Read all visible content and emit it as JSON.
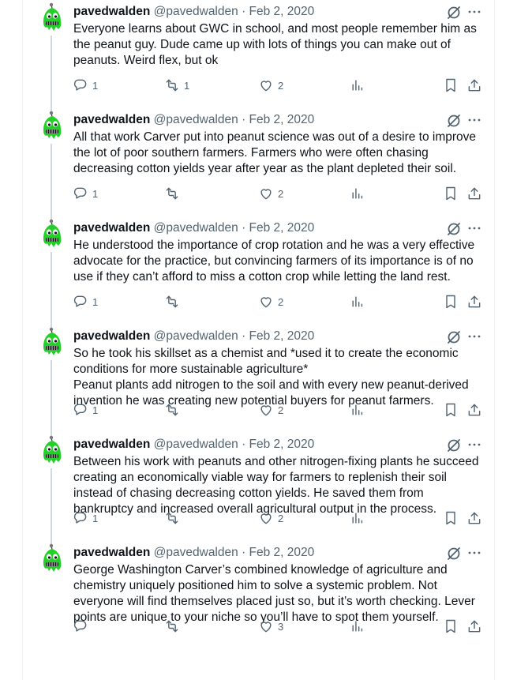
{
  "author": {
    "name": "pavedwalden",
    "handle": "@pavedwalden",
    "date_sep": "·",
    "date": "Feb 2, 2020"
  },
  "icons": {
    "reply": "reply-icon",
    "retweet": "retweet-icon",
    "like": "heart-icon",
    "views": "analytics-icon",
    "bookmark": "bookmark-icon",
    "share": "share-icon",
    "grok": "grok-icon",
    "more": "more-icon"
  },
  "colors": {
    "text": "#0f1419",
    "muted": "#536471",
    "thread_line": "#cfd9de",
    "avatar_green": "#22d028"
  },
  "tweets": [
    {
      "paragraphs": [
        "Everyone learns about GWC in school, and most people remember him as the peanut guy. Dude came up with lots of things you can make out of peanuts. Weird flex, but ok"
      ],
      "replies": "1",
      "retweets": "1",
      "likes": "2"
    },
    {
      "paragraphs": [
        "All that work Carver put into peanut science was out of a desire to improve the lot of poor southern farmers. Farmers who were often chasing decreasing cotton yields year after year as the plant depleted their soil."
      ],
      "replies": "1",
      "retweets": "",
      "likes": "2"
    },
    {
      "paragraphs": [
        "He understood the importance of crop rotation and he was a very effective advocate for the practice, but convincing farmers of its importance is of no use if they can’t afford to miss a cotton crop while letting the land rest."
      ],
      "replies": "1",
      "retweets": "",
      "likes": "2"
    },
    {
      "paragraphs": [
        "So he took his skillset as a chemist and *used it to create the economic conditions for more sustainable agriculture*",
        "Peanut plants add nitrogen to the soil and with every new peanut-derived invention he was creating new potential buyers for peanut farmers."
      ],
      "replies": "1",
      "retweets": "",
      "likes": "2"
    },
    {
      "paragraphs": [
        "Between his work with peanuts and other nitrogen-fixing plants he succeed creating an economically viable way for farmers to replenish their soil instead of chasing decreasing cotton yields. He saved them from bankruptcy and increased overall agricultural output in the process."
      ],
      "replies": "1",
      "retweets": "",
      "likes": "2"
    },
    {
      "paragraphs": [
        "George Washington Carver’s combined knowledge of agriculture and chemistry uniquely positioned him to solve a systemic problem. Not everyone will find themselves placed just so, but it’s worth checking. Lever points are unique to your niche so you’ll have to spot them yourself."
      ],
      "replies": "",
      "retweets": "",
      "likes": "3"
    }
  ]
}
